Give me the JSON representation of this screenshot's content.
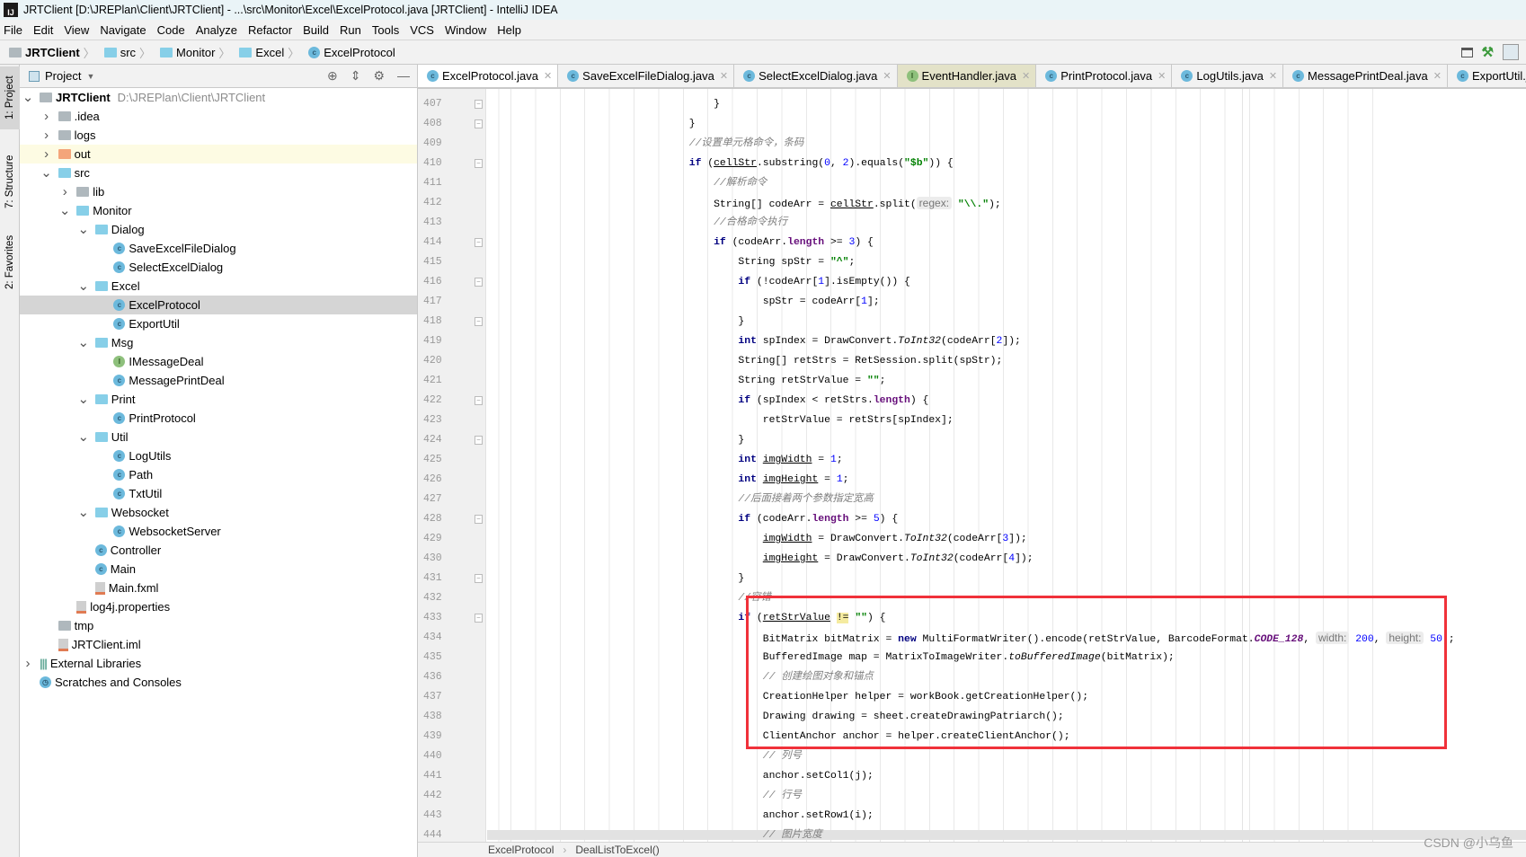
{
  "window": {
    "title": "JRTClient [D:\\JREPlan\\Client\\JRTClient] - ...\\src\\Monitor\\Excel\\ExcelProtocol.java [JRTClient] - IntelliJ IDEA",
    "logo": "IJ"
  },
  "menu": [
    "File",
    "Edit",
    "View",
    "Navigate",
    "Code",
    "Analyze",
    "Refactor",
    "Build",
    "Run",
    "Tools",
    "VCS",
    "Window",
    "Help"
  ],
  "breadcrumb": [
    {
      "label": "JRTClient",
      "icon": "module-icon"
    },
    {
      "label": "src",
      "icon": "folder-icon"
    },
    {
      "label": "Monitor",
      "icon": "folder-icon"
    },
    {
      "label": "Excel",
      "icon": "folder-icon"
    },
    {
      "label": "ExcelProtocol",
      "icon": "class-icon"
    }
  ],
  "side_tabs": [
    "1: Project",
    "7: Structure",
    "2: Favorites"
  ],
  "project_panel": {
    "title": "Project",
    "tree": [
      {
        "label": "JRTClient",
        "level": 0,
        "arrow": "open",
        "icon": "module",
        "bold": true,
        "path": "D:\\JREPlan\\Client\\JRTClient"
      },
      {
        "label": ".idea",
        "level": 1,
        "arrow": "closed",
        "icon": "folder-gray"
      },
      {
        "label": "logs",
        "level": 1,
        "arrow": "closed",
        "icon": "folder-gray"
      },
      {
        "label": "out",
        "level": 1,
        "arrow": "closed",
        "icon": "folder-orange",
        "highlight": true
      },
      {
        "label": "src",
        "level": 1,
        "arrow": "open",
        "icon": "folder"
      },
      {
        "label": "lib",
        "level": 2,
        "arrow": "closed",
        "icon": "folder-gray"
      },
      {
        "label": "Monitor",
        "level": 2,
        "arrow": "open",
        "icon": "folder"
      },
      {
        "label": "Dialog",
        "level": 3,
        "arrow": "open",
        "icon": "folder"
      },
      {
        "label": "SaveExcelFileDialog",
        "level": 4,
        "icon": "class"
      },
      {
        "label": "SelectExcelDialog",
        "level": 4,
        "icon": "class"
      },
      {
        "label": "Excel",
        "level": 3,
        "arrow": "open",
        "icon": "folder"
      },
      {
        "label": "ExcelProtocol",
        "level": 4,
        "icon": "class",
        "selected": true
      },
      {
        "label": "ExportUtil",
        "level": 4,
        "icon": "class"
      },
      {
        "label": "Msg",
        "level": 3,
        "arrow": "open",
        "icon": "folder"
      },
      {
        "label": "IMessageDeal",
        "level": 4,
        "icon": "interface"
      },
      {
        "label": "MessagePrintDeal",
        "level": 4,
        "icon": "class"
      },
      {
        "label": "Print",
        "level": 3,
        "arrow": "open",
        "icon": "folder"
      },
      {
        "label": "PrintProtocol",
        "level": 4,
        "icon": "class"
      },
      {
        "label": "Util",
        "level": 3,
        "arrow": "open",
        "icon": "folder"
      },
      {
        "label": "LogUtils",
        "level": 4,
        "icon": "class"
      },
      {
        "label": "Path",
        "level": 4,
        "icon": "class"
      },
      {
        "label": "TxtUtil",
        "level": 4,
        "icon": "class"
      },
      {
        "label": "Websocket",
        "level": 3,
        "arrow": "open",
        "icon": "folder"
      },
      {
        "label": "WebsocketServer",
        "level": 4,
        "icon": "class"
      },
      {
        "label": "Controller",
        "level": 3,
        "icon": "class"
      },
      {
        "label": "Main",
        "level": 3,
        "icon": "class"
      },
      {
        "label": "Main.fxml",
        "level": 3,
        "icon": "file"
      },
      {
        "label": "log4j.properties",
        "level": 2,
        "icon": "file"
      },
      {
        "label": "tmp",
        "level": 1,
        "icon": "folder-gray"
      },
      {
        "label": "JRTClient.iml",
        "level": 1,
        "icon": "file"
      },
      {
        "label": "External Libraries",
        "level": 0,
        "arrow": "closed",
        "icon": "library"
      },
      {
        "label": "Scratches and Consoles",
        "level": 0,
        "icon": "scratch"
      }
    ]
  },
  "tabs": [
    {
      "label": "ExcelProtocol.java",
      "icon": "class",
      "active": true
    },
    {
      "label": "SaveExcelFileDialog.java",
      "icon": "class"
    },
    {
      "label": "SelectExcelDialog.java",
      "icon": "class"
    },
    {
      "label": "EventHandler.java",
      "icon": "interface",
      "tinted": true
    },
    {
      "label": "PrintProtocol.java",
      "icon": "class"
    },
    {
      "label": "LogUtils.java",
      "icon": "class"
    },
    {
      "label": "MessagePrintDeal.java",
      "icon": "class"
    },
    {
      "label": "ExportUtil.java",
      "icon": "class"
    }
  ],
  "code": [
    {
      "n": "407",
      "indent": 36,
      "fold": true,
      "t": [
        [
          "}",
          "p"
        ]
      ]
    },
    {
      "n": "408",
      "indent": 32,
      "fold": true,
      "t": [
        [
          "}",
          "p"
        ]
      ]
    },
    {
      "n": "409",
      "indent": 32,
      "t": [
        [
          "//设置单元格命令，条码",
          "c"
        ]
      ]
    },
    {
      "n": "410",
      "indent": 32,
      "fold": true,
      "t": [
        [
          "if",
          "k"
        ],
        [
          " (",
          "p"
        ],
        [
          "cellStr",
          "u"
        ],
        [
          ".substring(",
          "p"
        ],
        [
          "0",
          "n"
        ],
        [
          ", ",
          "p"
        ],
        [
          "2",
          "n"
        ],
        [
          ").equals(",
          "p"
        ],
        [
          "\"$b\"",
          "s"
        ],
        [
          ")) {",
          "p"
        ]
      ]
    },
    {
      "n": "411",
      "indent": 36,
      "t": [
        [
          "//解析命令",
          "c"
        ]
      ]
    },
    {
      "n": "412",
      "indent": 36,
      "t": [
        [
          "String[] codeArr = ",
          "p"
        ],
        [
          "cellStr",
          "u"
        ],
        [
          ".split(",
          "p"
        ],
        [
          "regex:",
          "h"
        ],
        [
          " ",
          "p"
        ],
        [
          "\"\\\\.\"",
          "s"
        ],
        [
          ");",
          "p"
        ]
      ]
    },
    {
      "n": "413",
      "indent": 36,
      "t": [
        [
          "//合格命令执行",
          "c"
        ]
      ]
    },
    {
      "n": "414",
      "indent": 36,
      "fold": true,
      "t": [
        [
          "if",
          "k"
        ],
        [
          " (codeArr.",
          "p"
        ],
        [
          "length",
          "f"
        ],
        [
          " >= ",
          "p"
        ],
        [
          "3",
          "n"
        ],
        [
          ") {",
          "p"
        ]
      ]
    },
    {
      "n": "415",
      "indent": 40,
      "t": [
        [
          "String spStr = ",
          "p"
        ],
        [
          "\"^\"",
          "s"
        ],
        [
          ";",
          "p"
        ]
      ]
    },
    {
      "n": "416",
      "indent": 40,
      "fold": true,
      "t": [
        [
          "if",
          "k"
        ],
        [
          " (!codeArr[",
          "p"
        ],
        [
          "1",
          "n"
        ],
        [
          "].isEmpty()) {",
          "p"
        ]
      ]
    },
    {
      "n": "417",
      "indent": 44,
      "t": [
        [
          "spStr = codeArr[",
          "p"
        ],
        [
          "1",
          "n"
        ],
        [
          "];",
          "p"
        ]
      ]
    },
    {
      "n": "418",
      "indent": 40,
      "fold": true,
      "t": [
        [
          "}",
          "p"
        ]
      ]
    },
    {
      "n": "419",
      "indent": 40,
      "t": [
        [
          "int",
          "k"
        ],
        [
          " spIndex = DrawConvert.",
          "p"
        ],
        [
          "ToInt32",
          "i"
        ],
        [
          "(codeArr[",
          "p"
        ],
        [
          "2",
          "n"
        ],
        [
          "]);",
          "p"
        ]
      ]
    },
    {
      "n": "420",
      "indent": 40,
      "t": [
        [
          "String[] retStrs = RetSession.split(spStr);",
          "p"
        ]
      ]
    },
    {
      "n": "421",
      "indent": 40,
      "t": [
        [
          "String retStrValue = ",
          "p"
        ],
        [
          "\"\"",
          "s"
        ],
        [
          ";",
          "p"
        ]
      ]
    },
    {
      "n": "422",
      "indent": 40,
      "fold": true,
      "t": [
        [
          "if",
          "k"
        ],
        [
          " (spIndex < retStrs.",
          "p"
        ],
        [
          "length",
          "f"
        ],
        [
          ") {",
          "p"
        ]
      ]
    },
    {
      "n": "423",
      "indent": 44,
      "t": [
        [
          "retStrValue = retStrs[spIndex];",
          "p"
        ]
      ]
    },
    {
      "n": "424",
      "indent": 40,
      "fold": true,
      "t": [
        [
          "}",
          "p"
        ]
      ]
    },
    {
      "n": "425",
      "indent": 40,
      "t": [
        [
          "int",
          "k"
        ],
        [
          " ",
          "p"
        ],
        [
          "imgWidth",
          "u"
        ],
        [
          " = ",
          "p"
        ],
        [
          "1",
          "n"
        ],
        [
          ";",
          "p"
        ]
      ]
    },
    {
      "n": "426",
      "indent": 40,
      "t": [
        [
          "int",
          "k"
        ],
        [
          " ",
          "p"
        ],
        [
          "imgHeight",
          "u"
        ],
        [
          " = ",
          "p"
        ],
        [
          "1",
          "n"
        ],
        [
          ";",
          "p"
        ]
      ]
    },
    {
      "n": "427",
      "indent": 40,
      "t": [
        [
          "//后面接着两个参数指定宽高",
          "c"
        ]
      ]
    },
    {
      "n": "428",
      "indent": 40,
      "fold": true,
      "t": [
        [
          "if",
          "k"
        ],
        [
          " (codeArr.",
          "p"
        ],
        [
          "length",
          "f"
        ],
        [
          " >= ",
          "p"
        ],
        [
          "5",
          "n"
        ],
        [
          ") {",
          "p"
        ]
      ]
    },
    {
      "n": "429",
      "indent": 44,
      "t": [
        [
          "imgWidth",
          "u"
        ],
        [
          " = DrawConvert.",
          "p"
        ],
        [
          "ToInt32",
          "i"
        ],
        [
          "(codeArr[",
          "p"
        ],
        [
          "3",
          "n"
        ],
        [
          "]);",
          "p"
        ]
      ]
    },
    {
      "n": "430",
      "indent": 44,
      "t": [
        [
          "imgHeight",
          "u"
        ],
        [
          " = DrawConvert.",
          "p"
        ],
        [
          "ToInt32",
          "i"
        ],
        [
          "(codeArr[",
          "p"
        ],
        [
          "4",
          "n"
        ],
        [
          "]);",
          "p"
        ]
      ]
    },
    {
      "n": "431",
      "indent": 40,
      "fold": true,
      "t": [
        [
          "}",
          "p"
        ]
      ]
    },
    {
      "n": "432",
      "indent": 40,
      "t": [
        [
          "//容错",
          "c"
        ]
      ]
    },
    {
      "n": "433",
      "indent": 40,
      "fold": true,
      "t": [
        [
          "if",
          "k"
        ],
        [
          " (",
          "p"
        ],
        [
          "retStrValue",
          "u"
        ],
        [
          " ",
          "p"
        ],
        [
          "!=",
          "hl"
        ],
        [
          " ",
          "p"
        ],
        [
          "\"\"",
          "s"
        ],
        [
          ") {",
          "p"
        ]
      ]
    },
    {
      "n": "434",
      "indent": 44,
      "t": [
        [
          "BitMatrix bitMatrix = ",
          "p"
        ],
        [
          "new",
          "k"
        ],
        [
          " MultiFormatWriter().encode(retStrValue, BarcodeFormat.",
          "p"
        ],
        [
          "CODE_128",
          "ic"
        ],
        [
          ", ",
          "p"
        ],
        [
          "width:",
          "h"
        ],
        [
          " ",
          "p"
        ],
        [
          "200",
          "n"
        ],
        [
          ", ",
          "p"
        ],
        [
          "height:",
          "h"
        ],
        [
          " ",
          "p"
        ],
        [
          "50",
          "n"
        ],
        [
          ");",
          "p"
        ]
      ]
    },
    {
      "n": "435",
      "indent": 44,
      "t": [
        [
          "BufferedImage map = MatrixToImageWriter.",
          "p"
        ],
        [
          "toBufferedImage",
          "i"
        ],
        [
          "(bitMatrix);",
          "p"
        ]
      ]
    },
    {
      "n": "436",
      "indent": 44,
      "t": [
        [
          "// 创建绘图对象和锚点",
          "c"
        ]
      ]
    },
    {
      "n": "437",
      "indent": 44,
      "t": [
        [
          "CreationHelper helper = workBook.getCreationHelper();",
          "p"
        ]
      ]
    },
    {
      "n": "438",
      "indent": 44,
      "t": [
        [
          "Drawing drawing = sheet.createDrawingPatriarch();",
          "p"
        ]
      ]
    },
    {
      "n": "439",
      "indent": 44,
      "t": [
        [
          "ClientAnchor anchor = helper.createClientAnchor();",
          "p"
        ]
      ]
    },
    {
      "n": "440",
      "indent": 44,
      "t": [
        [
          "// 列号",
          "c"
        ]
      ]
    },
    {
      "n": "441",
      "indent": 44,
      "t": [
        [
          "anchor.setCol1(j);",
          "p"
        ]
      ]
    },
    {
      "n": "442",
      "indent": 44,
      "t": [
        [
          "// 行号",
          "c"
        ]
      ]
    },
    {
      "n": "443",
      "indent": 44,
      "t": [
        [
          "anchor.setRow1(i);",
          "p"
        ]
      ]
    },
    {
      "n": "444",
      "indent": 44,
      "t": [
        [
          "// 图片宽度",
          "c"
        ]
      ]
    }
  ],
  "status_breadcrumb": [
    "ExcelProtocol",
    "DealListToExcel()"
  ],
  "watermark": "CSDN @小乌鱼",
  "colors": {
    "highlight_box": "#f0313a",
    "keyword": "#000080",
    "string": "#008000",
    "number": "#0000ff",
    "field": "#660e7a",
    "comment": "#808080"
  }
}
